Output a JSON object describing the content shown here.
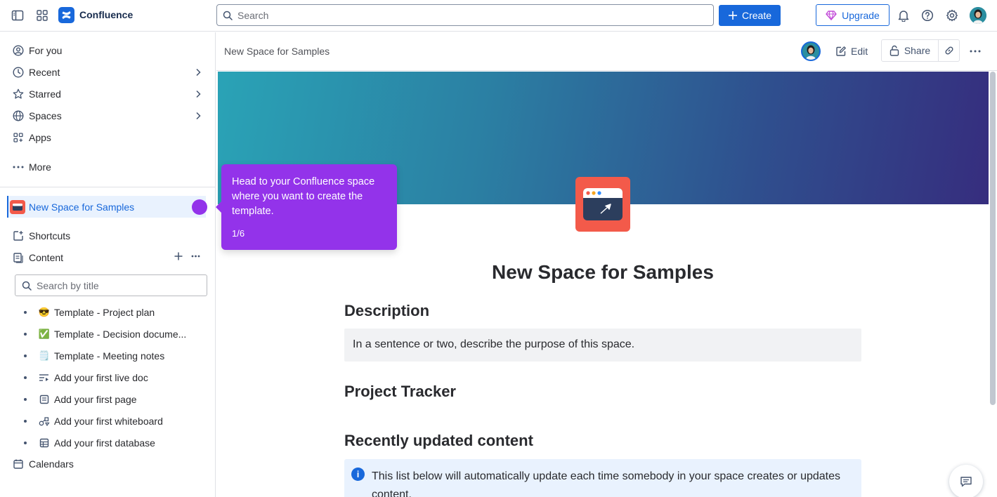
{
  "topbar": {
    "app_name": "Confluence",
    "search_placeholder": "Search",
    "create_label": "Create",
    "upgrade_label": "Upgrade",
    "brand_color": "#1868db"
  },
  "sidebar": {
    "nav": [
      {
        "label": "For you",
        "icon": "user-circle-icon"
      },
      {
        "label": "Recent",
        "icon": "clock-icon"
      },
      {
        "label": "Starred",
        "icon": "star-icon"
      },
      {
        "label": "Spaces",
        "icon": "globe-icon"
      },
      {
        "label": "Apps",
        "icon": "apps-icon"
      },
      {
        "label": "More",
        "icon": "more-icon"
      }
    ],
    "space_name": "New Space for Samples",
    "shortcuts_label": "Shortcuts",
    "content_label": "Content",
    "search_placeholder": "Search by title",
    "tree": [
      {
        "icon": "😎",
        "label": "Template - Project plan"
      },
      {
        "icon": "✅",
        "label": "Template - Decision docume..."
      },
      {
        "icon": "🗒️",
        "label": "Template - Meeting notes"
      },
      {
        "icon": "live-doc-icon",
        "label": "Add your first live doc"
      },
      {
        "icon": "page-icon",
        "label": "Add your first page"
      },
      {
        "icon": "whiteboard-icon",
        "label": "Add your first whiteboard"
      },
      {
        "icon": "database-icon",
        "label": "Add your first database"
      }
    ],
    "calendars_label": "Calendars"
  },
  "main": {
    "breadcrumb": "New Space for Samples",
    "edit_label": "Edit",
    "share_label": "Share",
    "page_title": "New Space for Samples",
    "description_heading": "Description",
    "description_text": "In a sentence or two, describe the purpose of this space.",
    "tracker_heading": "Project Tracker",
    "recent_heading": "Recently updated content",
    "info_text": "This list below will automatically update each time somebody in your space creates or updates content."
  },
  "tooltip": {
    "text": "Head to your Confluence space where you want to create the template.",
    "step": "1/6",
    "color": "#9333ea"
  }
}
